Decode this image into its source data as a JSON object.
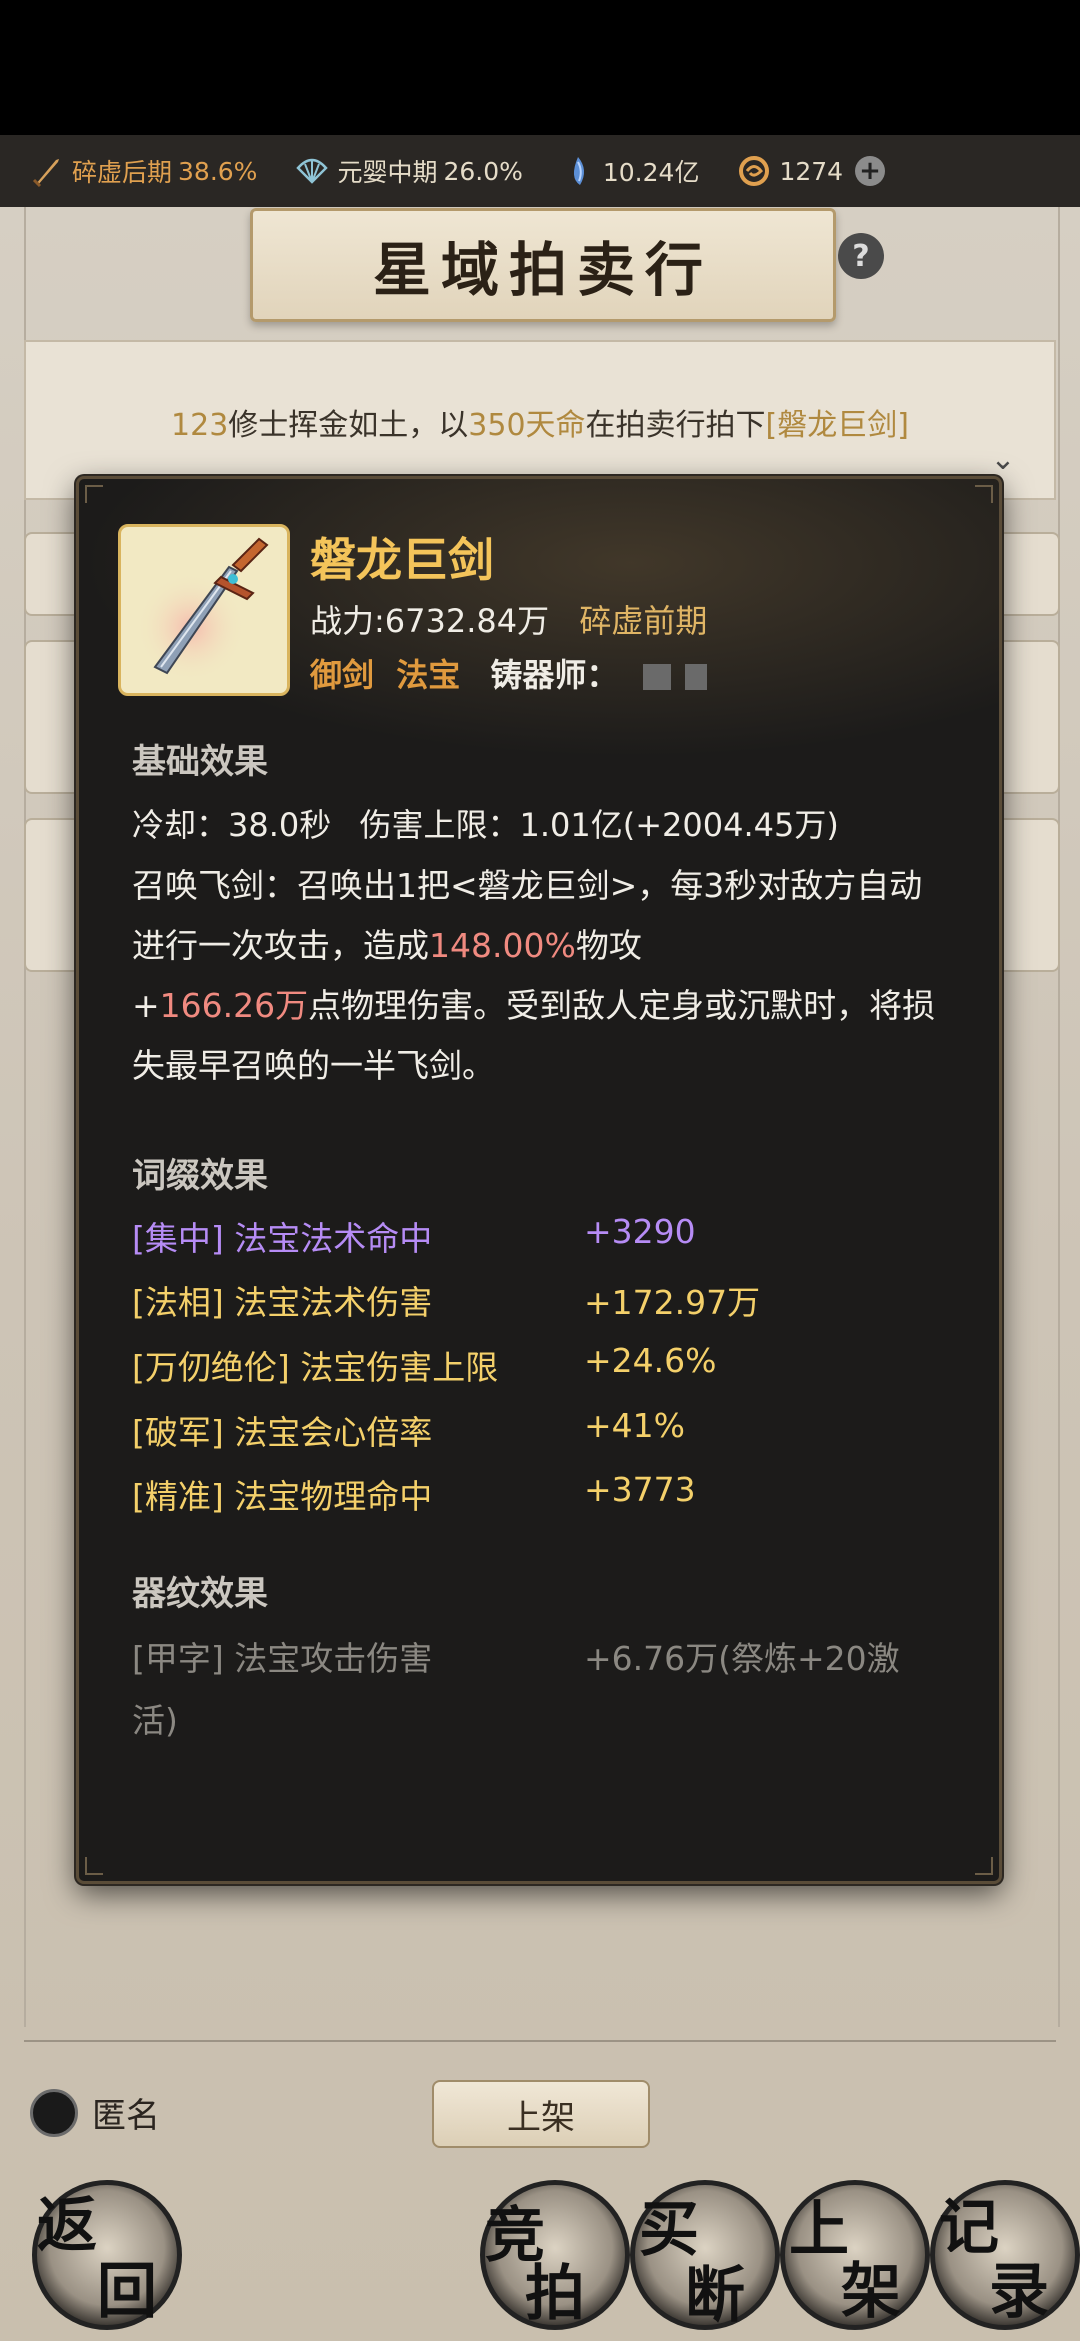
{
  "resources": {
    "stage1_label": "碎虚后期",
    "stage1_pct": "38.6%",
    "stage2_label": "元婴中期",
    "stage2_pct": "26.0%",
    "spirit_stones": "10.24亿",
    "currency": "1274"
  },
  "title": "星域拍卖行",
  "help": "?",
  "notice": {
    "count": "123",
    "text1": "修士挥金如土，以",
    "price": "350天命",
    "text2": "在拍卖行拍下",
    "item": "[磐龙巨剑]"
  },
  "item": {
    "name": "磐龙巨剑",
    "power_label": "战力:",
    "power_value": "6732.84万",
    "stage": "碎虚前期",
    "type1": "御剑",
    "type2": "法宝",
    "smith_label": "铸器师：",
    "base_header": "基础效果",
    "cooldown_label": "冷却：",
    "cooldown_value": "38.0秒",
    "cap_label": "伤害上限：",
    "cap_value": "1.01亿(+2004.45万)",
    "desc_a": "召唤飞剑：召唤出1把<磐龙巨剑>，每3秒对敌方自动进行一次攻击，造成",
    "desc_pct": "148.00%",
    "desc_b": "物攻",
    "desc_plus": "+",
    "desc_dmg": "166.26万",
    "desc_c": "点物理伤害。受到敌人定身或沉默时，将损失最早召唤的一半飞剑。",
    "affix_header": "词缀效果",
    "affixes": [
      {
        "name": "[集中] 法宝法术命中",
        "value": "+3290",
        "color": "#b68cf5"
      },
      {
        "name": "[法相] 法宝法术伤害",
        "value": "+172.97万",
        "color": "#f4d06a"
      },
      {
        "name": "[万仞绝伦] 法宝伤害上限",
        "value": "+24.6%",
        "color": "#f4d06a"
      },
      {
        "name": "[破军] 法宝会心倍率",
        "value": "+41%",
        "color": "#f4d06a"
      },
      {
        "name": "[精准] 法宝物理命中",
        "value": "+3773",
        "color": "#f4d06a"
      }
    ],
    "pattern_header": "器纹效果",
    "pattern_name": "[甲字] 法宝攻击伤害",
    "pattern_value": "+6.76万(祭炼+20激",
    "pattern_value2": "活)"
  },
  "bottom": {
    "anonymous": "匿名",
    "list_button": "上架"
  },
  "nav": {
    "back": [
      "返",
      "回"
    ],
    "auction": [
      "竞",
      "拍"
    ],
    "buyout": [
      "买",
      "断"
    ],
    "shelf": [
      "上",
      "架"
    ],
    "records": [
      "记",
      "录"
    ]
  }
}
